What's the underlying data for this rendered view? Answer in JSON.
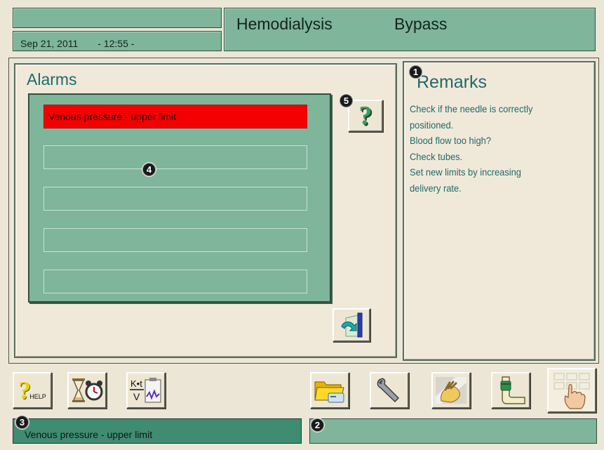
{
  "header": {
    "date": "Sep 21, 2011",
    "time": "- 12:55 -",
    "mode": "Hemodialysis",
    "submode": "Bypass"
  },
  "alarms": {
    "title": "Alarms",
    "rows": [
      "Venous pressure - upper limit",
      "",
      "",
      "",
      ""
    ]
  },
  "remarks": {
    "title": "Remarks",
    "lines": [
      "Check if the needle is correctly",
      "positioned.",
      "Blood flow too high?",
      "Check tubes.",
      "Set new limits by increasing",
      "delivery rate."
    ]
  },
  "toolbar": {
    "help_label": "HELP",
    "ktv_top": "K•t",
    "ktv_bottom": "V",
    "question_mark": "?"
  },
  "status": {
    "message": "Venous pressure - upper limit",
    "right": ""
  },
  "callouts": [
    "1",
    "2",
    "3",
    "4",
    "5"
  ],
  "icons": {
    "help": "help-icon",
    "timer": "hourglass-alarm-clock-icon",
    "ktv": "ktv-clipboard-icon",
    "folder": "folder-card-icon",
    "wrench": "wrench-icon",
    "clean": "disinfection-hand-icon",
    "arm": "arm-cuff-icon",
    "keypad": "keypad-hand-icon",
    "exit": "exit-arrow-icon",
    "question": "question-icon"
  },
  "colors": {
    "teal": "#7fb59a",
    "active_alarm": "#f40000",
    "status_dark": "#3f8c73",
    "heading": "#1e6a6a"
  }
}
